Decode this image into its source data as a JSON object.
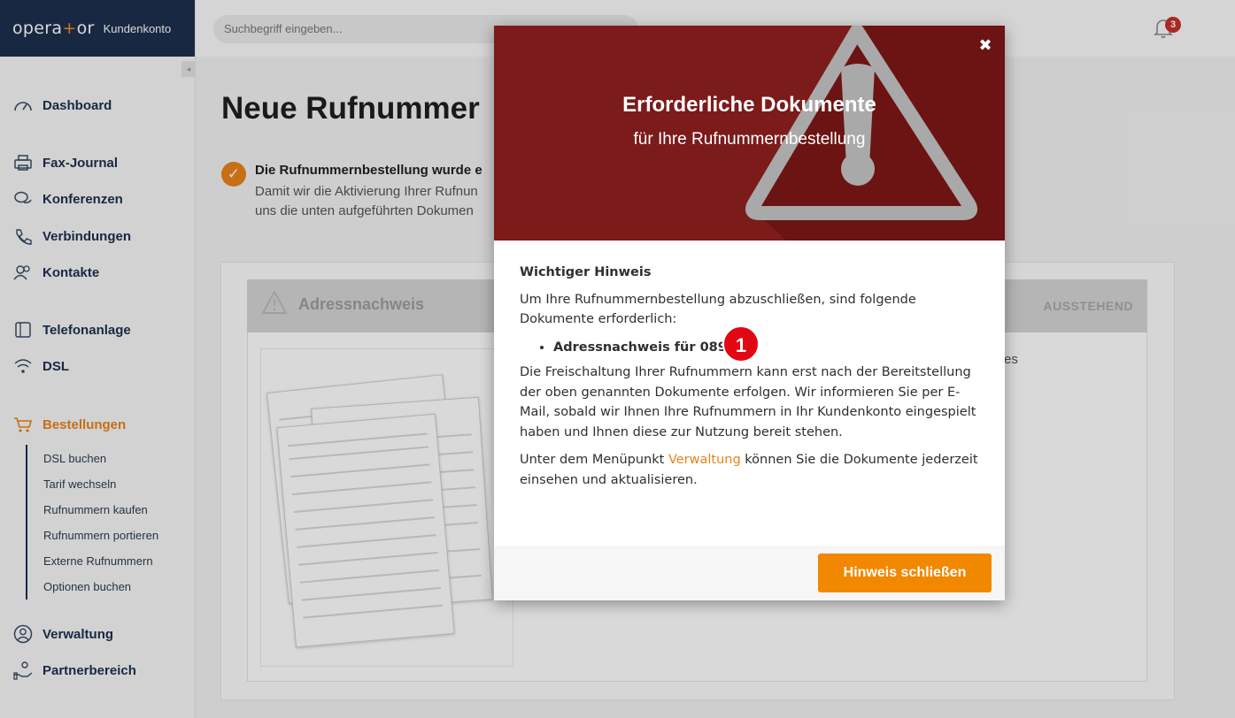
{
  "brand": {
    "logo": "opera+or",
    "logo_left": "opera",
    "logo_plus": "+",
    "logo_right": "or",
    "subtitle": "Kundenkonto"
  },
  "sidebar": {
    "collapse_glyph": "◂",
    "items": [
      {
        "label": "Dashboard",
        "icon": "speedometer-icon"
      },
      {
        "label": "Fax-Journal",
        "icon": "fax-icon"
      },
      {
        "label": "Konferenzen",
        "icon": "chat-bubbles-icon"
      },
      {
        "label": "Verbindungen",
        "icon": "phone-icon"
      },
      {
        "label": "Kontakte",
        "icon": "contacts-icon"
      },
      {
        "label": "Telefonanlage",
        "icon": "pbx-icon"
      },
      {
        "label": "DSL",
        "icon": "wifi-icon"
      },
      {
        "label": "Bestellungen",
        "icon": "cart-icon",
        "active": true
      },
      {
        "label": "Verwaltung",
        "icon": "user-circle-icon"
      },
      {
        "label": "Partnerbereich",
        "icon": "partner-icon"
      }
    ],
    "subitems": [
      "DSL buchen",
      "Tarif wechseln",
      "Rufnummern kaufen",
      "Rufnummern portieren",
      "Externe Rufnummern",
      "Optionen buchen"
    ]
  },
  "topbar": {
    "search_placeholder": "Suchbegriff eingeben...",
    "notification_count": "3"
  },
  "main": {
    "title": "Neue Rufnummer",
    "success_title": "Die Rufnummernbestellung wurde e",
    "success_text": "Damit wir die Aktivierung Ihrer Rufnun uns die unten aufgeführten Dokumen",
    "doc_label": "Adressnachweis",
    "doc_status": "AUSSTEHEND",
    "side_text": "es"
  },
  "modal": {
    "title": "Erforderliche Dokumente",
    "subtitle": "für Ihre Rufnummernbestellung",
    "close": "✖",
    "heading": "Wichtiger Hinweis",
    "intro": "Um Ihre Rufnummernbestellung abzuschließen, sind folgende Dokumente erforderlich:",
    "required_doc": "Adressnachweis für 089",
    "marker": "1",
    "info": "Die Freischaltung Ihrer Rufnummern kann erst nach der Bereitstellung der oben genannten Dokumente erfolgen. Wir informieren Sie per E-Mail, sobald wir Ihnen Ihre Rufnummern in Ihr Kundenkonto eingespielt haben und Ihnen diese zur Nutzung bereit stehen.",
    "menu_before": "Unter dem Menüpunkt ",
    "menu_link": "Verwaltung",
    "menu_after": " können Sie die Dokumente jederzeit einsehen und aktualisieren.",
    "button": "Hinweis schließen"
  },
  "colors": {
    "brand_navy": "#1d2f4f",
    "accent_orange": "#e98318",
    "modal_red": "#7b1b1a",
    "marker_red": "#e30613"
  }
}
